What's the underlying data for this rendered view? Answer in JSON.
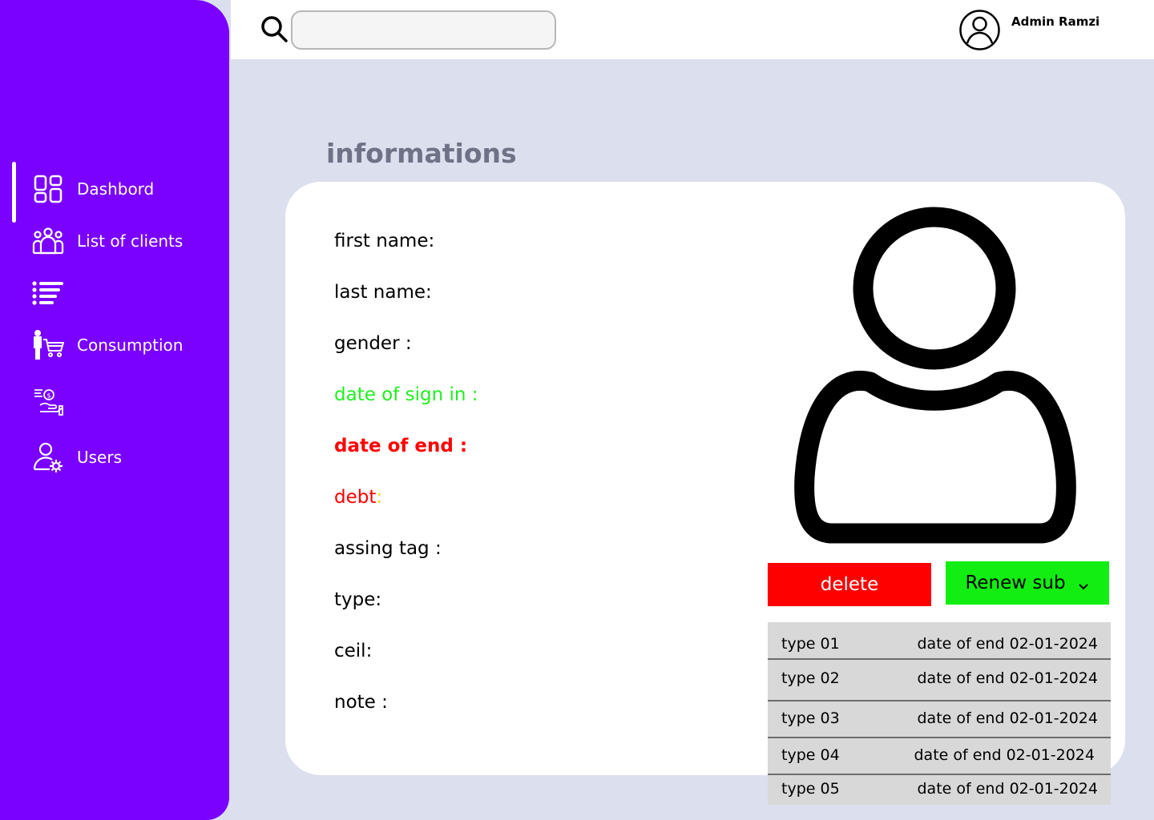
{
  "sidebar": {
    "items": [
      {
        "label": "Dashbord",
        "icon": "dashboard-grid-icon"
      },
      {
        "label": "List of clients",
        "icon": "clients-group-icon"
      },
      {
        "label": "",
        "icon": "list-icon"
      },
      {
        "label": "Consumption",
        "icon": "shopping-cart-person-icon"
      },
      {
        "label": "",
        "icon": "payment-hand-icon"
      },
      {
        "label": "Users",
        "icon": "user-gear-icon"
      }
    ]
  },
  "topbar": {
    "search_placeholder": "",
    "admin_name": "Admin Ramzi"
  },
  "main": {
    "section_title": "informations",
    "fields": [
      {
        "label": "first name:"
      },
      {
        "label": "last name:"
      },
      {
        "label": "gender :"
      },
      {
        "label": "date of sign in :"
      },
      {
        "label": "date of end :"
      },
      {
        "label": "debt",
        "suffix": ":"
      },
      {
        "label": "assing tag :"
      },
      {
        "label": "type:"
      },
      {
        "label": "ceil:"
      },
      {
        "label": "note :"
      }
    ],
    "buttons": {
      "delete": "delete",
      "renew": "Renew sub"
    },
    "renew_options": [
      {
        "type": "type 01",
        "date": "date of end 02-01-2024"
      },
      {
        "type": "type 02",
        "date": "date of end 02-01-2024"
      },
      {
        "type": "type 03",
        "date": "date of end 02-01-2024"
      },
      {
        "type": "type 04",
        "date": "date of end 02-01-2024"
      },
      {
        "type": "type 05",
        "date": "date of end 02-01-2024"
      }
    ]
  },
  "colors": {
    "sidebar": "#7a00ff",
    "background": "#dcdfee",
    "delete": "#ff0000",
    "renew": "#12ee12",
    "sign_in_date": "#1ff01f",
    "end_date": "#ff0000"
  }
}
